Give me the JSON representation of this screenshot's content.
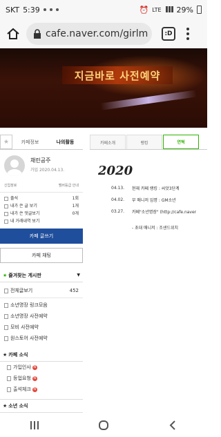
{
  "status": {
    "carrier": "SKT",
    "time": "5:39",
    "battery": "29%",
    "net": "LTE"
  },
  "browser": {
    "url": "cafe.naver.com/girlm",
    "tab_count": ":D"
  },
  "banner": {
    "text": "지금바로 사전예약"
  },
  "left": {
    "tabs": [
      "카페정보",
      "나의활동"
    ],
    "profile": {
      "name": "채린공주",
      "join": "가입 2020.04.13."
    },
    "grade": {
      "left": "신입장로",
      "right": "멤버등급 안내"
    },
    "stats": [
      {
        "label": "출석",
        "value": "1회"
      },
      {
        "label": "내가 쓴 글 보기",
        "value": "1개"
      },
      {
        "label": "내가 쓴 댓글보기",
        "value": "0개"
      },
      {
        "label": "내 거래내역 보기",
        "value": ""
      }
    ],
    "write_button": "카페 글쓰기",
    "chat_button": "카페 채팅",
    "fav_title": "즐겨찾는 게시판",
    "all_posts": "전체글보기",
    "all_posts_count": "452",
    "boards": [
      "소년명장 링크모음",
      "소년명장 사전예약",
      "모비 사전예약",
      "원스토어 사전예약"
    ],
    "news_title": "카페 소식",
    "news_items": [
      "가입인사",
      "등업요청",
      "출석체크"
    ],
    "boy_title": "소년 소식"
  },
  "right": {
    "tabs": [
      "카페소개",
      "랭킹",
      "연혁"
    ],
    "year": "2020",
    "history": [
      {
        "date": "04.13.",
        "text": "현재 카페 랭킹 : 씨앗3단계"
      },
      {
        "date": "04.02.",
        "text": "부 매니저 임명 : GM소년"
      },
      {
        "date": "03.27.",
        "text": "카페\"소년명장\" (http://cafe.naver"
      }
    ],
    "leader": "- 초대 매니저 : 조샌드위치"
  }
}
